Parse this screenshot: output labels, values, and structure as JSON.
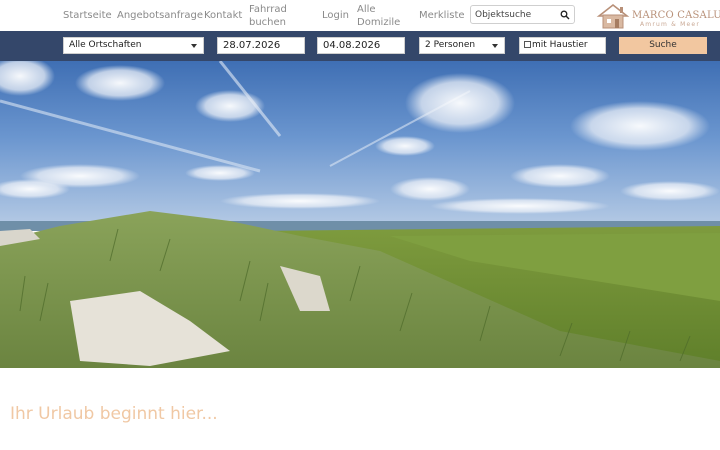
{
  "nav": {
    "items": [
      {
        "label": "Startseite"
      },
      {
        "label": "Angebotsanfrage"
      },
      {
        "label": "Kontakt"
      },
      {
        "label": "Fahrrad buchen"
      },
      {
        "label": "Login"
      },
      {
        "label": "Alle Domizile"
      },
      {
        "label": "Merkliste"
      }
    ],
    "search_placeholder": "Objektsuche",
    "search_icon": "search-icon"
  },
  "logo": {
    "name": "MARCO CASALUCI",
    "tagline": "Amrum & Meer",
    "icon": "house-icon"
  },
  "searchbar": {
    "location": "Alle Ortschaften",
    "date_from": "28.07.2026",
    "date_to": "04.08.2026",
    "persons": "2 Personen",
    "pet_label": "mit Haustier",
    "pet_checked": false,
    "submit_label": "Suche"
  },
  "hero": {
    "description_icon": "dune-landscape-image"
  },
  "main": {
    "headline": "Ihr Urlaub beginnt hier..."
  },
  "colors": {
    "searchbar_bg": "#34476a",
    "button_bg": "#f2c7a0",
    "accent_text": "#f0c8a4",
    "logo_text": "#b89078",
    "nav_text": "#8a8a8a"
  }
}
